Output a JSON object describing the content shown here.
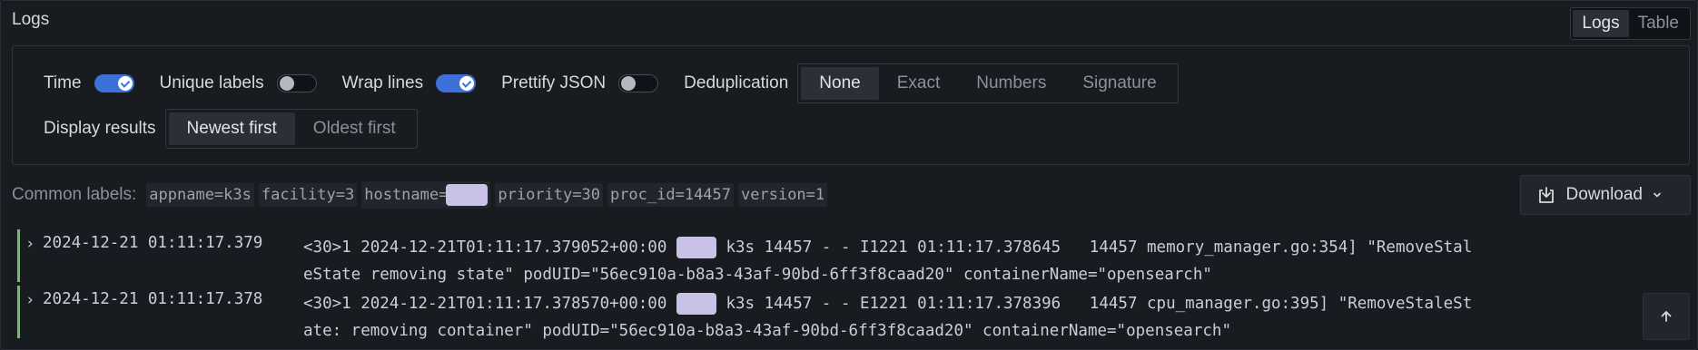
{
  "panel": {
    "title": "Logs",
    "view_modes": [
      "Logs",
      "Table"
    ],
    "active_view": "Logs"
  },
  "options": {
    "time_label": "Time",
    "time_on": true,
    "unique_labels_label": "Unique labels",
    "unique_labels_on": false,
    "wrap_lines_label": "Wrap lines",
    "wrap_lines_on": true,
    "prettify_json_label": "Prettify JSON",
    "prettify_json_on": false,
    "dedup_label": "Deduplication",
    "dedup_options": [
      "None",
      "Exact",
      "Numbers",
      "Signature"
    ],
    "dedup_active": "None",
    "display_results_label": "Display results",
    "order_options": [
      "Newest first",
      "Oldest first"
    ],
    "order_active": "Newest first"
  },
  "common_labels": {
    "title": "Common labels:",
    "chips": {
      "appname": "appname=k3s",
      "facility": "facility=3",
      "hostname": "hostname=",
      "priority": "priority=30",
      "proc_id": "proc_id=14457",
      "version": "version=1"
    }
  },
  "download": {
    "label": "Download"
  },
  "logs": [
    {
      "timestamp": "2024-12-21 01:11:17.379",
      "line1_pre": "<30>1 2024-12-21T01:11:17.379052+00:00 ",
      "line1_post": " k3s 14457 - - I1221 01:11:17.378645   14457 memory_manager.go:354] \"RemoveStal",
      "line2": "eState removing state\" podUID=\"56ec910a-b8a3-43af-90bd-6ff3f8caad20\" containerName=\"opensearch\""
    },
    {
      "timestamp": "2024-12-21 01:11:17.378",
      "line1_pre": "<30>1 2024-12-21T01:11:17.378570+00:00 ",
      "line1_post": " k3s 14457 - - E1221 01:11:17.378396   14457 cpu_manager.go:395] \"RemoveStaleSt",
      "line2": "ate: removing container\" podUID=\"56ec910a-b8a3-43af-90bd-6ff3f8caad20\" containerName=\"opensearch\""
    }
  ],
  "colors": {
    "accent": "#3d71d9",
    "log_level_bar": "#73bf69",
    "background": "#181b1f",
    "redaction": "#c9c2e6"
  },
  "icons": {
    "download": "download-icon",
    "chevron_down": "chevron-down-icon",
    "expand_row": "chevron-right-icon",
    "scroll_top": "arrow-up-icon",
    "check": "check-icon"
  }
}
